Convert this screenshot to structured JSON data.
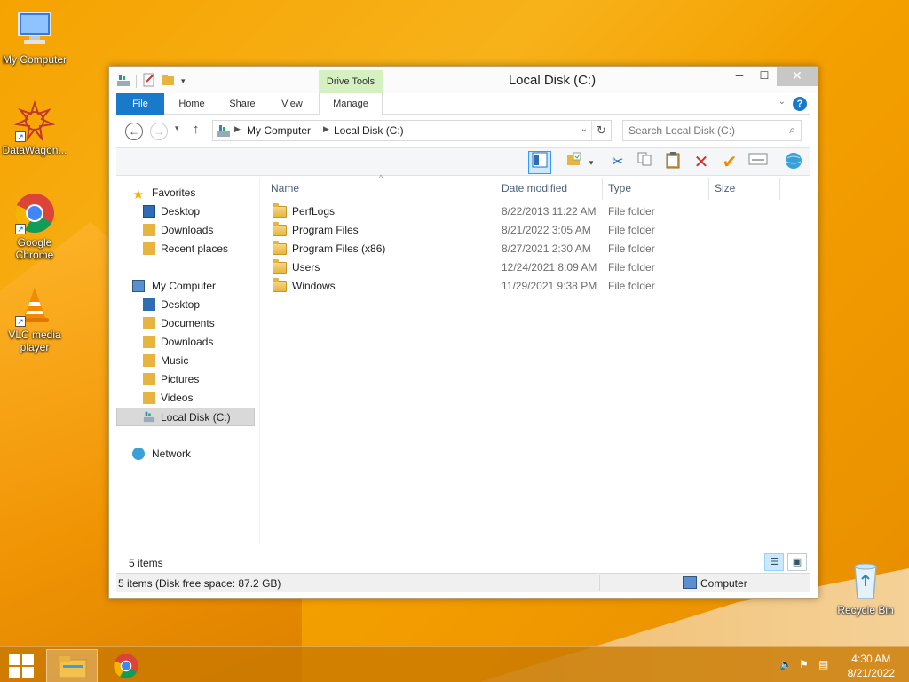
{
  "desktop": {
    "icons": [
      {
        "label": "My Computer"
      },
      {
        "label": "DataWagon..."
      },
      {
        "label": "Google Chrome"
      },
      {
        "label": "VLC media player"
      },
      {
        "label": "Recycle Bin"
      }
    ]
  },
  "window": {
    "title": "Local Disk (C:)",
    "contextual_tab_group": "Drive Tools",
    "ribbon_tabs": [
      "File",
      "Home",
      "Share",
      "View",
      "Manage"
    ],
    "help": "?",
    "address": {
      "crumbs": [
        "My Computer",
        "Local Disk (C:)"
      ]
    },
    "search": {
      "placeholder": "Search Local Disk (C:)"
    },
    "nav": {
      "favorites": {
        "label": "Favorites",
        "items": [
          "Desktop",
          "Downloads",
          "Recent places"
        ]
      },
      "computer": {
        "label": "My Computer",
        "items": [
          "Desktop",
          "Documents",
          "Downloads",
          "Music",
          "Pictures",
          "Videos",
          "Local Disk (C:)"
        ]
      },
      "network": {
        "label": "Network"
      }
    },
    "columns": {
      "name": "Name",
      "date": "Date modified",
      "type": "Type",
      "size": "Size"
    },
    "files": [
      {
        "name": "PerfLogs",
        "date": "8/22/2013 11:22 AM",
        "type": "File folder"
      },
      {
        "name": "Program Files",
        "date": "8/21/2022 3:05 AM",
        "type": "File folder"
      },
      {
        "name": "Program Files (x86)",
        "date": "8/27/2021 2:30 AM",
        "type": "File folder"
      },
      {
        "name": "Users",
        "date": "12/24/2021 8:09 AM",
        "type": "File folder"
      },
      {
        "name": "Windows",
        "date": "11/29/2021 9:38 PM",
        "type": "File folder"
      }
    ],
    "status": {
      "item_count": "5 items"
    },
    "details": {
      "summary": "5 items (Disk free space: 87.2 GB)",
      "location": "Computer"
    }
  },
  "taskbar": {
    "time": "4:30 AM",
    "date": "8/21/2022"
  },
  "colors": {
    "accent": "#1979ca",
    "drive_tools": "#d5f0c1",
    "taskbar": "#c87800"
  }
}
